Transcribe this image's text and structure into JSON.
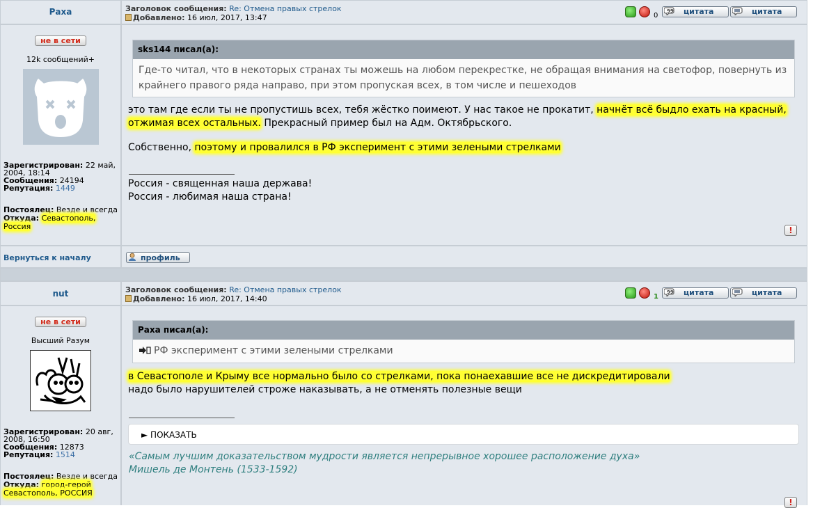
{
  "post1": {
    "author": "Раха",
    "status": "не в сети",
    "rank": "12k сообщений+",
    "subject_label": "Заголовок сообщения:",
    "subject": "Re: Отмена правых стрелок",
    "added_label": "Добавлено:",
    "added": "16 июл, 2017, 13:47",
    "vote_count": "0",
    "quote_btn1": "цитата",
    "quote_btn2": "цитата",
    "registered_label": "Зарегистрирован:",
    "registered_1": "22 май,",
    "registered_2": "2004, 18:14",
    "messages_label": "Сообщения:",
    "messages": "24194",
    "reputation_label": "Репутация:",
    "reputation": "1449",
    "resident_label": "Постоялец:",
    "resident": "Везде и всегда",
    "from_label": "Откуда:",
    "from_1": "Севастополь,",
    "from_2": "Россия",
    "quote_author": "sks144 писал(а):",
    "quote_line1": "Где-то читал, что в некоторых странах ты можешь на любом перекрестке, не обращая внимания на светофор, повернуть из",
    "quote_line2": "крайнего правого ряда направо, при этом пропуская всех, в том числе и пешеходов",
    "text_a": "это там где если ты не пропустишь всех, тебя жёстко поимеют. У нас такое не прокатит, ",
    "text_a_hl": "начнёт всё быдло ехать на красный,",
    "text_b_hl": "отжимая всех остальных.",
    "text_b": " Прекрасный пример был на Адм. Октябрьского.",
    "text_c": "Собственно, ",
    "text_c_hl": "поэтому и провалился в РФ эксперимент с этими зелеными стрелками ",
    "sig_1": "Россия - священная наша держава!",
    "sig_2": "Россия - любимая наша страна!",
    "back_link": "Вернуться к началу",
    "profile_btn": "профиль"
  },
  "post2": {
    "author": "nut",
    "status": "не в сети",
    "rank": "Высший Разум",
    "subject_label": "Заголовок сообщения:",
    "subject": "Re: Отмена правых стрелок",
    "added_label": "Добавлено:",
    "added": "16 июл, 2017, 14:40",
    "vote_count": "1",
    "quote_btn1": "цитата",
    "quote_btn2": "цитата",
    "registered_label": "Зарегистрирован:",
    "registered_1": "20 авг,",
    "registered_2": "2008, 16:50",
    "messages_label": "Сообщения:",
    "messages": "12873",
    "reputation_label": "Репутация:",
    "reputation": "1514",
    "resident_label": "Постоялец:",
    "resident": "Везде и всегда",
    "from_label": "Откуда:",
    "from_1": "город-герой",
    "from_2": "Севастополь, РОССИЯ",
    "quote_author": "Раха писал(а):",
    "quote_line1": "РФ эксперимент с этими зелеными стрелками",
    "text_a_hl": "в Севастополе и Крыму все нормально было со стрелками, пока понаехавшие все не дискредитировали",
    "text_b": "надо было нарушителей строже наказывать, а не отменять полезные вещи",
    "spoiler": "► ПОКАЗАТЬ",
    "sig_quote_1": "«Самым лучшим доказательством мудрости является непрерывное хорошее расположение духа»",
    "sig_quote_2": "Мишель де Монтень (1533-1592)"
  }
}
